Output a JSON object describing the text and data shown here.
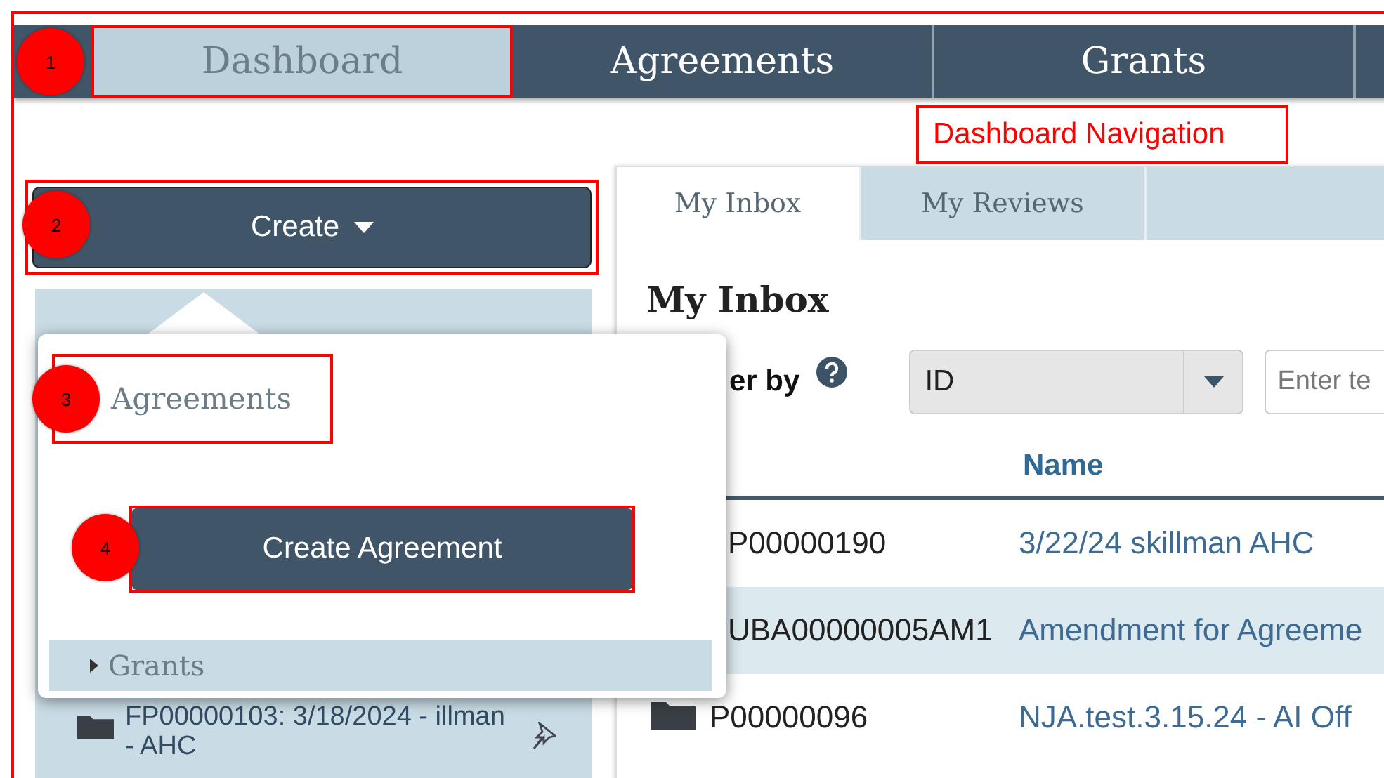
{
  "nav": {
    "tabs": [
      {
        "label": "Dashboard",
        "selected": true,
        "highlighted": true,
        "marker": "1"
      },
      {
        "label": "Agreements",
        "selected": false,
        "highlighted": false
      },
      {
        "label": "Grants",
        "selected": false,
        "highlighted": false
      }
    ]
  },
  "callout": {
    "text": "Dashboard Navigation"
  },
  "sidebar": {
    "create_button": {
      "label": "Create",
      "highlighted": true,
      "marker": "2"
    },
    "items": [
      {
        "label": "FP00000103: 3/18/2024 - illman - AHC"
      }
    ]
  },
  "create_menu": {
    "section": {
      "label": "Agreements",
      "highlighted": true,
      "marker": "3"
    },
    "action": {
      "label": "Create Agreement",
      "highlighted": true,
      "marker": "4"
    },
    "groups": [
      {
        "label": "Grants",
        "expanded": false
      }
    ]
  },
  "inbox": {
    "tabs": [
      {
        "label": "My Inbox",
        "selected": true
      },
      {
        "label": "My Reviews",
        "selected": false
      }
    ],
    "title": "My Inbox",
    "filter": {
      "label": "er by",
      "field": "ID",
      "search_placeholder": "Enter te"
    },
    "table": {
      "columns": [
        "Name"
      ],
      "rows": [
        {
          "id": "P00000190",
          "name": "3/22/24 skillman AHC",
          "shaded": false,
          "folder_icon": false
        },
        {
          "id": "UBA00000005AM1",
          "name": "Amendment for Agreeme",
          "shaded": true,
          "folder_icon": false
        },
        {
          "id": "P00000096",
          "name": "NJA.test.3.15.24 - AI Off",
          "shaded": false,
          "folder_icon": true
        }
      ]
    }
  }
}
